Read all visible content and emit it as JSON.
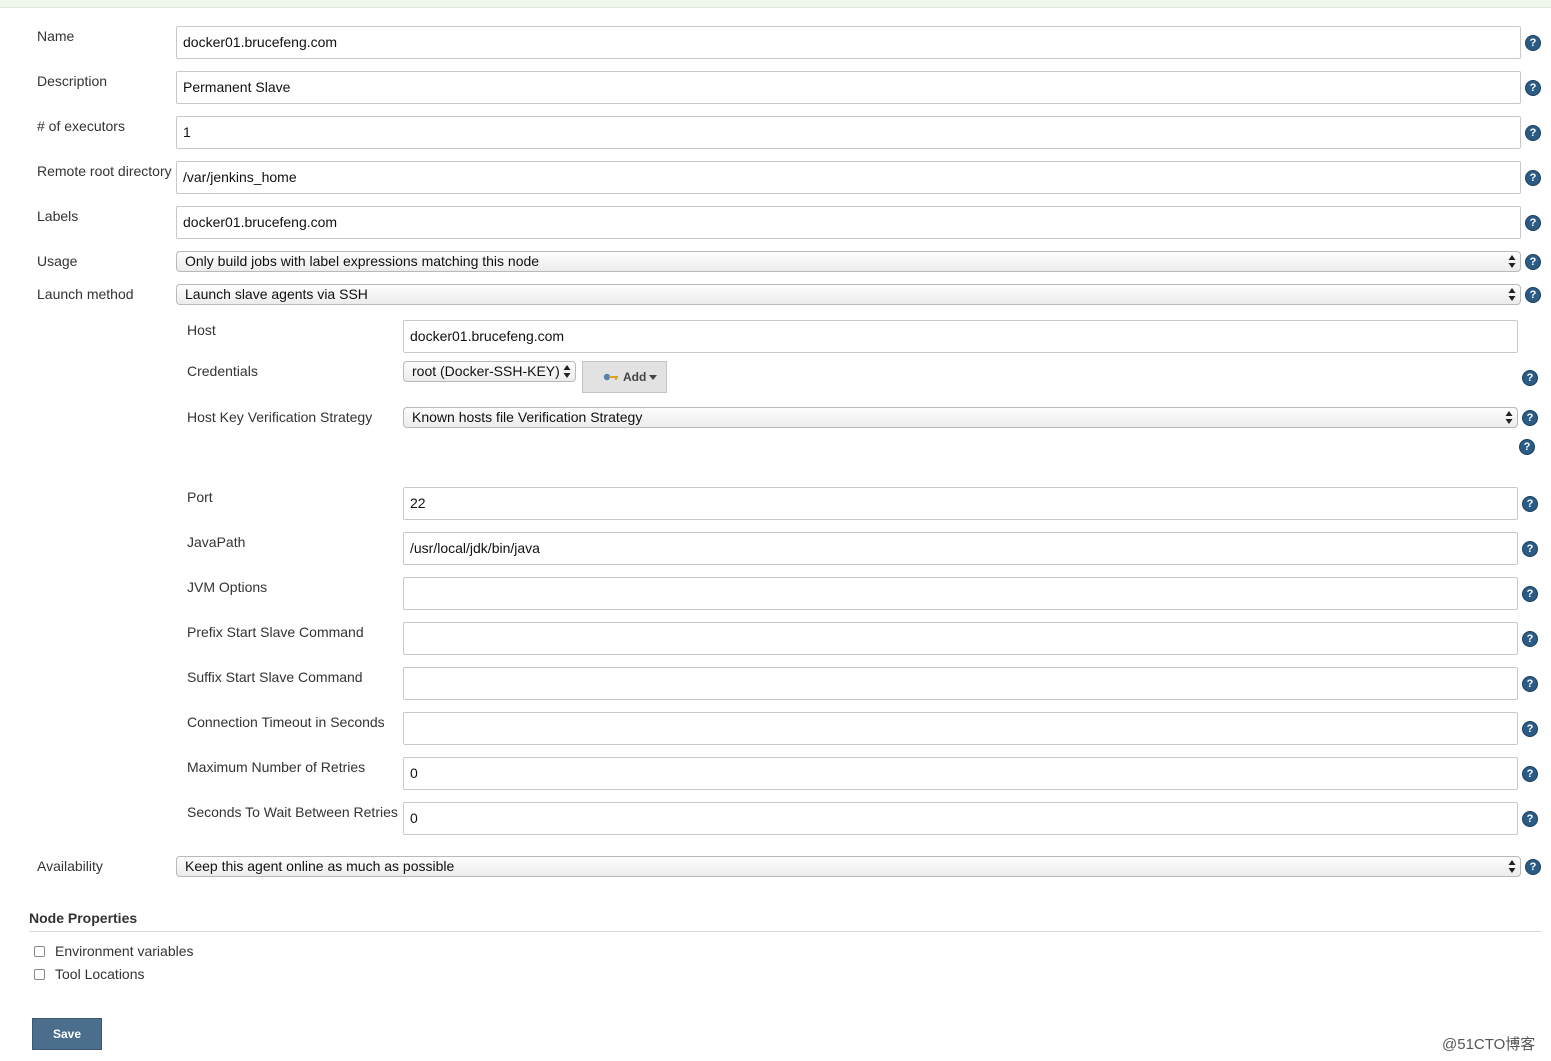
{
  "form": {
    "name": {
      "label": "Name",
      "value": "docker01.brucefeng.com"
    },
    "description": {
      "label": "Description",
      "value": "Permanent Slave"
    },
    "executors": {
      "label": "# of executors",
      "value": "1"
    },
    "remote_root": {
      "label": "Remote root directory",
      "value": "/var/jenkins_home"
    },
    "labels": {
      "label": "Labels",
      "value": "docker01.brucefeng.com"
    },
    "usage": {
      "label": "Usage",
      "value": "Only build jobs with label expressions matching this node"
    },
    "launch_method": {
      "label": "Launch method",
      "value": "Launch slave agents via SSH"
    },
    "availability": {
      "label": "Availability",
      "value": "Keep this agent online as much as possible"
    }
  },
  "ssh": {
    "host": {
      "label": "Host",
      "value": "docker01.brucefeng.com"
    },
    "credentials": {
      "label": "Credentials",
      "value": "root (Docker-SSH-KEY)",
      "add_label": "Add"
    },
    "host_key": {
      "label": "Host Key Verification Strategy",
      "value": "Known hosts file Verification Strategy"
    },
    "port": {
      "label": "Port",
      "value": "22"
    },
    "java_path": {
      "label": "JavaPath",
      "value": "/usr/local/jdk/bin/java"
    },
    "jvm_options": {
      "label": "JVM Options",
      "value": ""
    },
    "prefix_cmd": {
      "label": "Prefix Start Slave Command",
      "value": ""
    },
    "suffix_cmd": {
      "label": "Suffix Start Slave Command",
      "value": ""
    },
    "conn_timeout": {
      "label": "Connection Timeout in Seconds",
      "value": ""
    },
    "max_retries": {
      "label": "Maximum Number of Retries",
      "value": "0"
    },
    "wait_retries": {
      "label": "Seconds To Wait Between Retries",
      "value": "0"
    }
  },
  "node_properties": {
    "title": "Node Properties",
    "items": [
      {
        "label": "Environment variables",
        "checked": false
      },
      {
        "label": "Tool Locations",
        "checked": false
      }
    ]
  },
  "save_label": "Save",
  "help_glyph": "?",
  "watermark": "@51CTO博客",
  "colors": {
    "help": "#2b5c86",
    "save": "#4b6e8c",
    "topbar": "#f1f6ec"
  }
}
